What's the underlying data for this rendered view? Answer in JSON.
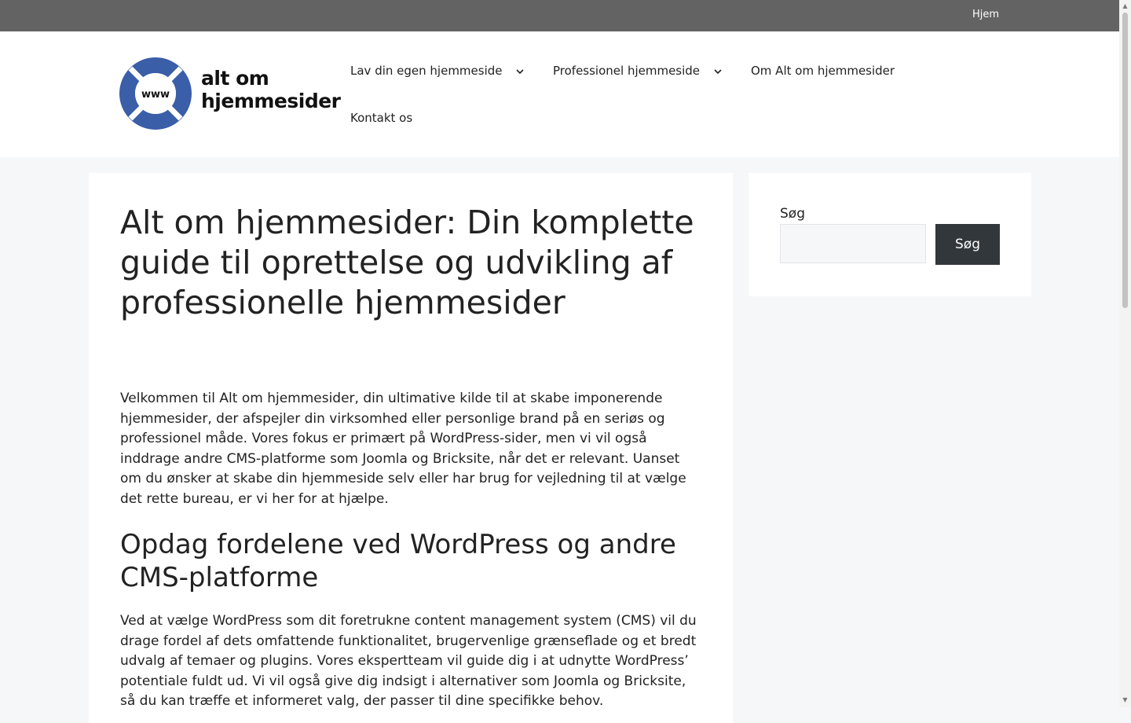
{
  "topbar": {
    "link_label": "Hjem"
  },
  "header": {
    "logo": {
      "icon_text": "www",
      "line1": "alt om",
      "line2": "hjemmesider"
    },
    "nav": [
      {
        "label": "Lav din egen hjemmeside",
        "has_dropdown": true
      },
      {
        "label": "Professionel hjemmeside",
        "has_dropdown": true
      },
      {
        "label": "Om Alt om hjemmesider",
        "has_dropdown": false
      },
      {
        "label": "Kontakt os",
        "has_dropdown": false
      }
    ]
  },
  "main": {
    "title": "Alt om hjemmesider: Din komplette guide til oprettelse og udvikling af professionelle hjemmesider",
    "intro": "Velkommen til Alt om hjemmesider, din ultimative kilde til at skabe imponerende hjemmesider, der afspejler din virksomhed eller personlige brand på en seriøs og professionel måde. Vores fokus er primært på WordPress-sider, men vi vil også inddrage andre CMS-platforme som Joomla og Bricksite, når det er relevant. Uanset om du ønsker at skabe din hjemmeside selv eller har brug for vejledning til at vælge det rette bureau, er vi her for at hjælpe.",
    "section_heading": "Opdag fordelene ved WordPress og andre CMS-platforme",
    "section_text": "Ved at vælge WordPress som dit foretrukne content management system (CMS) vil du drage fordel af dets omfattende funktionalitet, brugervenlige grænseflade og et bredt udvalg af temaer og plugins. Vores ekspertteam vil guide dig i at udnytte WordPress’ potentiale fuldt ud. Vi vil også give dig indsigt i alternativer som Joomla og Bricksite, så du kan træffe et informeret valg, der passer til dine specifikke behov."
  },
  "sidebar": {
    "search_label": "Søg",
    "search_value": "",
    "search_button": "Søg"
  },
  "colors": {
    "topbar_bg": "#636363",
    "page_bg": "#f6f7f8",
    "logo_blue": "#3a5ea8",
    "button_bg": "#32373c"
  }
}
